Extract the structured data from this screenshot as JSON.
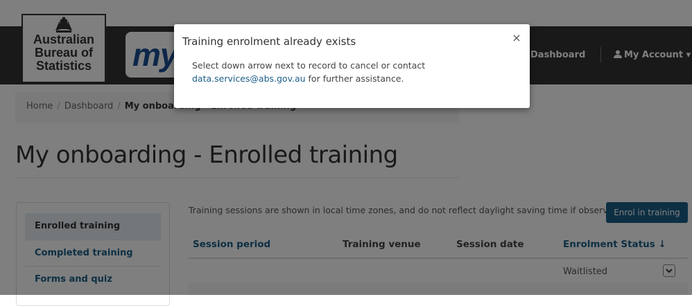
{
  "header": {
    "logo_lines": [
      "Australian",
      "Bureau of",
      "Statistics"
    ],
    "brand": "my",
    "nav": {
      "dashboard": "Dashboard",
      "account": "My Account"
    }
  },
  "breadcrumb": {
    "home": "Home",
    "dashboard": "Dashboard",
    "current": "My onboarding - Enrolled training"
  },
  "page_title": "My onboarding - Enrolled training",
  "sidebar": {
    "items": [
      {
        "label": "Enrolled training",
        "active": true
      },
      {
        "label": "Completed training"
      },
      {
        "label": "Forms and quiz"
      }
    ]
  },
  "main": {
    "notice": "Training sessions are shown in local time zones, and do not reflect daylight saving time if observed.",
    "enrol_button": "Enrol in training",
    "table": {
      "headers": [
        "Session period",
        "Training venue",
        "Session date",
        "Enrolment Status"
      ],
      "rows": [
        {
          "status": "Waitlisted"
        }
      ]
    }
  },
  "modal": {
    "title": "Training enrolment already exists",
    "close": "×",
    "line1": "Select down arrow next to record to cancel or contact",
    "email": "data.services@abs.gov.au",
    "line2_suffix": " for further assistance."
  },
  "colors": {
    "link": "#1b5e87",
    "dark_band": "#333333",
    "brand_blue": "#1b4f93"
  }
}
